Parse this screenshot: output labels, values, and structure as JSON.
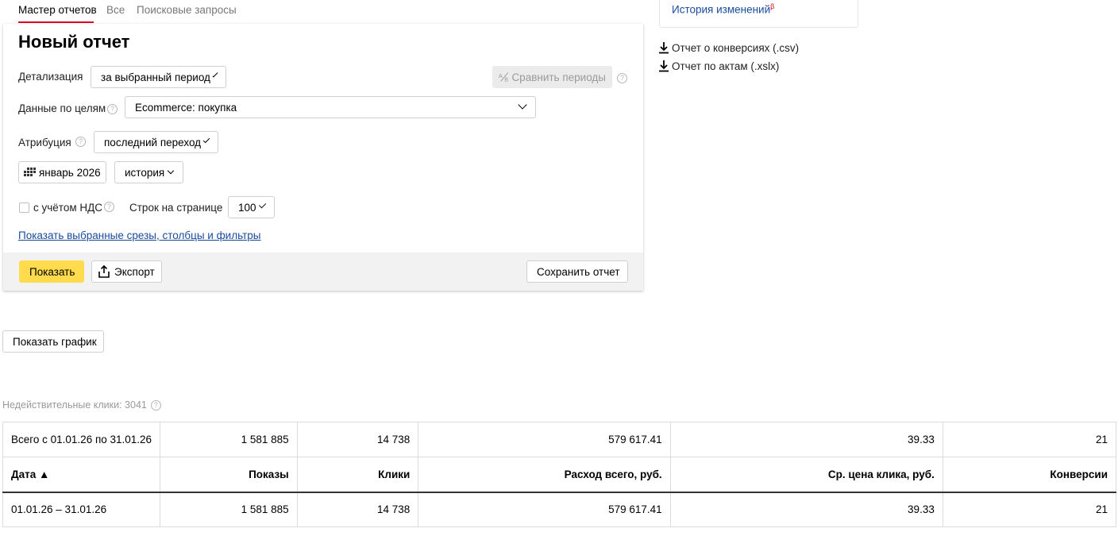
{
  "tabs": [
    "Мастер отчетов",
    "Все",
    "Поисковые запросы"
  ],
  "report": {
    "title": "Новый отчет",
    "detail_label": "Детализация",
    "detail_value": "за выбранный период",
    "compare_label": "Сравнить периоды",
    "goals_label": "Данные по целям",
    "goals_value": "Ecommerce: покупка",
    "attribution_label": "Атрибуция",
    "attribution_value": "последний переход",
    "period_value": "январь 2026",
    "history_value": "история",
    "vat_label": "с учётом НДС",
    "rows_label": "Строк на странице",
    "rows_value": "100",
    "filters_link": "Показать выбранные срезы, столбцы и фильтры",
    "show_button": "Показать",
    "export_button": "Экспорт",
    "save_button": "Сохранить отчет"
  },
  "side": {
    "history_link": "История изменений",
    "beta": "β",
    "downloads": [
      "Отчет о конверсиях (.csv)",
      "Отчет по актам (.xslx)"
    ]
  },
  "chart_button": "Показать график",
  "invalid_clicks": "Недействительные клики: 3041",
  "table": {
    "total_row": [
      "Всего с 01.01.26 по 31.01.26",
      "1 581 885",
      "14 738",
      "579 617.41",
      "39.33",
      "21"
    ],
    "headers": [
      "Дата ▲",
      "Показы",
      "Клики",
      "Расход всего, руб.",
      "Ср. цена клика, руб.",
      "Конверсии"
    ],
    "rows": [
      [
        "01.01.26 – 31.01.26",
        "1 581 885",
        "14 738",
        "579 617.41",
        "39.33",
        "21"
      ]
    ]
  },
  "colors": {
    "accent_yellow": "#ffdb4d",
    "link_blue": "#1a4b9c",
    "tab_red": "#e30020"
  }
}
